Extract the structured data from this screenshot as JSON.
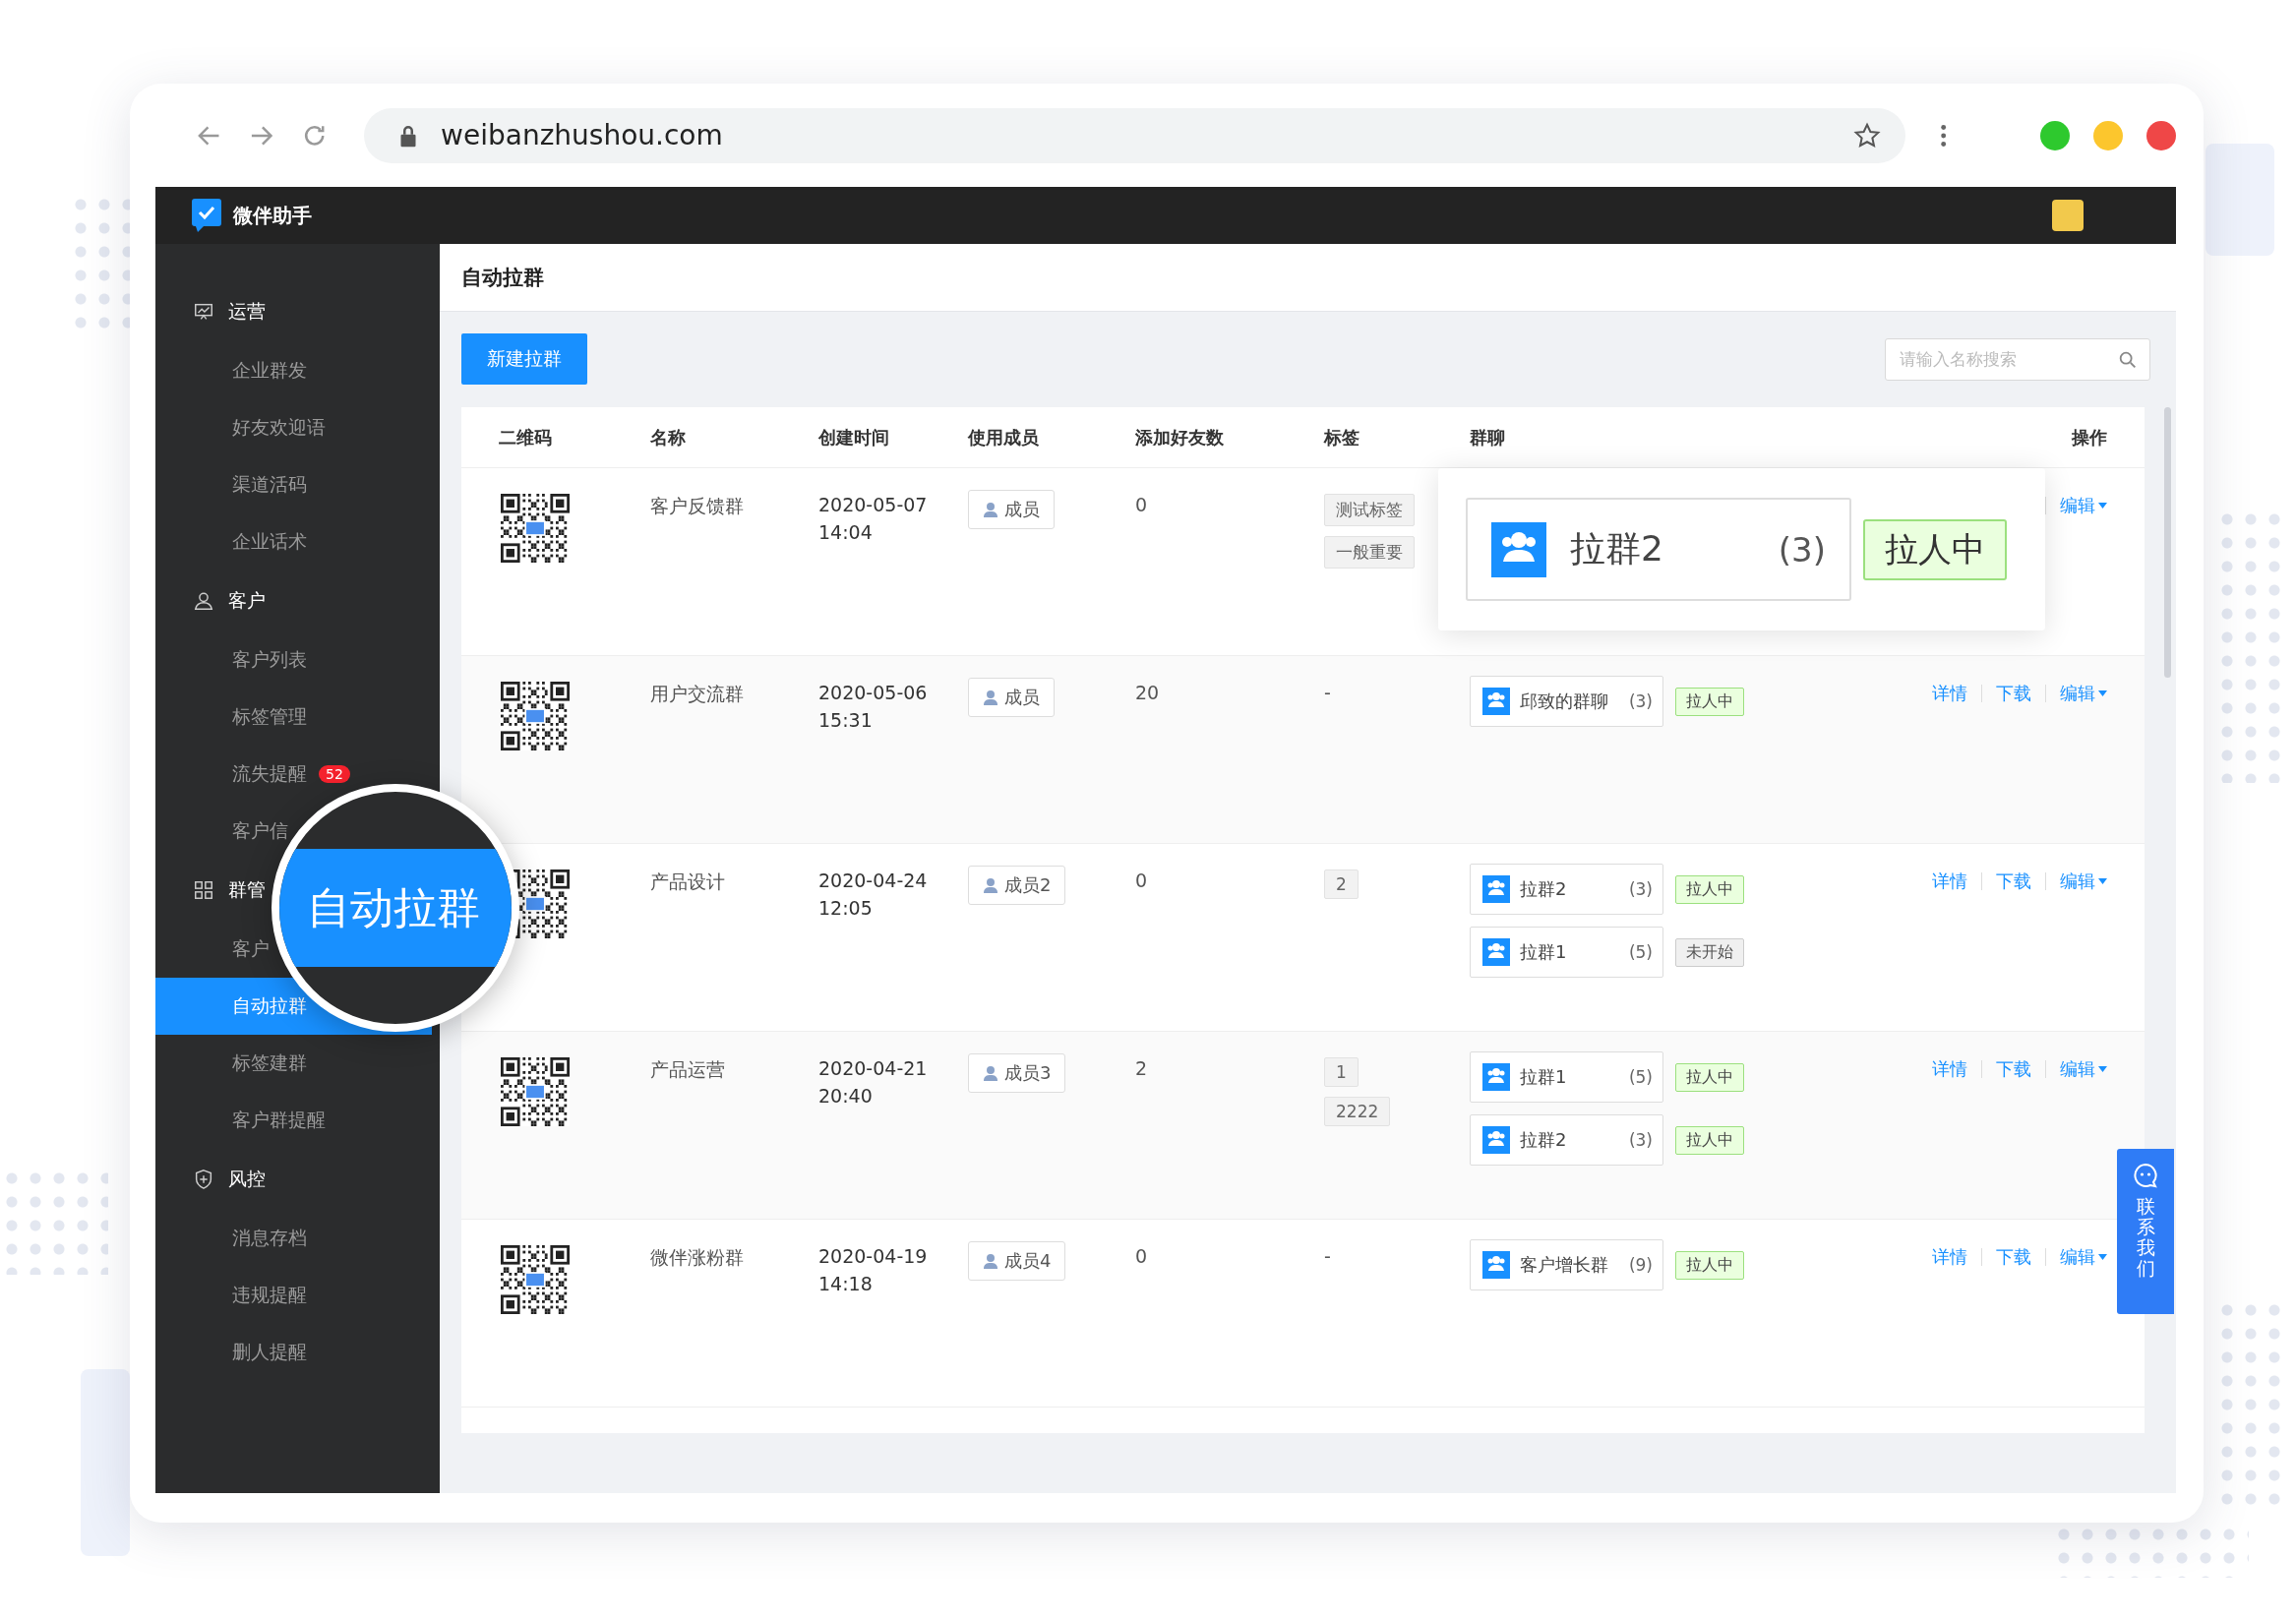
{
  "browser": {
    "url": "weibanzhushou.com"
  },
  "app": {
    "name": "微伴助手"
  },
  "sidebar": {
    "sections": [
      {
        "label": "运营",
        "items": [
          {
            "label": "企业群发",
            "selected": false
          },
          {
            "label": "好友欢迎语",
            "selected": false
          },
          {
            "label": "渠道活码",
            "selected": false
          },
          {
            "label": "企业话术",
            "selected": false
          }
        ]
      },
      {
        "label": "客户",
        "items": [
          {
            "label": "客户列表",
            "selected": false
          },
          {
            "label": "标签管理",
            "selected": false
          },
          {
            "label": "流失提醒",
            "selected": false,
            "badge": "52"
          },
          {
            "label": "客户信",
            "selected": false
          }
        ]
      },
      {
        "label": "群管",
        "items": [
          {
            "label": "客户",
            "selected": false
          },
          {
            "label": "自动拉群",
            "selected": true
          },
          {
            "label": "标签建群",
            "selected": false
          },
          {
            "label": "客户群提醒",
            "selected": false
          }
        ]
      },
      {
        "label": "风控",
        "items": [
          {
            "label": "消息存档",
            "selected": false
          },
          {
            "label": "违规提醒",
            "selected": false
          },
          {
            "label": "删人提醒",
            "selected": false
          }
        ]
      }
    ]
  },
  "magnifier": {
    "label": "自动拉群"
  },
  "page": {
    "title": "自动拉群",
    "new_button": "新建拉群",
    "search": {
      "placeholder": "请输入名称搜索"
    }
  },
  "table": {
    "columns": [
      "二维码",
      "名称",
      "创建时间",
      "使用成员",
      "添加好友数",
      "标签",
      "群聊",
      "操作"
    ],
    "rows": [
      {
        "name": "客户反馈群",
        "date": "2020-05-07",
        "time": "14:04",
        "member": "成员",
        "friends": "0",
        "tags": [
          "测试标签",
          "一般重要"
        ],
        "chats": [],
        "actions": [
          {
            "label": "编辑",
            "dropdown": true
          }
        ]
      },
      {
        "name": "用户交流群",
        "date": "2020-05-06",
        "time": "15:31",
        "member": "成员",
        "friends": "20",
        "tag_empty": "-",
        "chats": [
          {
            "name": "邱致的群聊",
            "count": "(3)",
            "status": "拉人中",
            "kind": "pulling"
          }
        ],
        "actions": [
          {
            "label": "详情",
            "dropdown": false
          },
          {
            "label": "下载",
            "dropdown": false
          },
          {
            "label": "编辑",
            "dropdown": true
          }
        ]
      },
      {
        "name": "产品设计",
        "date": "2020-04-24",
        "time": "12:05",
        "member": "成员2",
        "friends": "0",
        "tags": [
          "2"
        ],
        "chats": [
          {
            "name": "拉群2",
            "count": "(3)",
            "status": "拉人中",
            "kind": "pulling"
          },
          {
            "name": "拉群1",
            "count": "(5)",
            "status": "未开始",
            "kind": "not_started"
          }
        ],
        "actions": [
          {
            "label": "详情",
            "dropdown": false
          },
          {
            "label": "下载",
            "dropdown": false
          },
          {
            "label": "编辑",
            "dropdown": true
          }
        ]
      },
      {
        "name": "产品运营",
        "date": "2020-04-21",
        "time": "20:40",
        "member": "成员3",
        "friends": "2",
        "tags": [
          "1",
          "2222"
        ],
        "chats": [
          {
            "name": "拉群1",
            "count": "(5)",
            "status": "拉人中",
            "kind": "pulling"
          },
          {
            "name": "拉群2",
            "count": "(3)",
            "status": "拉人中",
            "kind": "pulling"
          }
        ],
        "actions": [
          {
            "label": "详情",
            "dropdown": false
          },
          {
            "label": "下载",
            "dropdown": false
          },
          {
            "label": "编辑",
            "dropdown": true
          }
        ]
      },
      {
        "name": "微伴涨粉群",
        "date": "2020-04-19",
        "time": "14:18",
        "member": "成员4",
        "friends": "0",
        "tag_empty": "-",
        "chats": [
          {
            "name": "客户增长群",
            "count": "(9)",
            "status": "拉人中",
            "kind": "pulling"
          }
        ],
        "actions": [
          {
            "label": "详情",
            "dropdown": false
          },
          {
            "label": "下载",
            "dropdown": false
          },
          {
            "label": "编辑",
            "dropdown": true
          }
        ]
      }
    ]
  },
  "popup": {
    "chat": {
      "name": "拉群2",
      "count": "(3)",
      "status": "拉人中",
      "kind": "pulling"
    }
  },
  "contact_button": {
    "label": "联系我们"
  }
}
